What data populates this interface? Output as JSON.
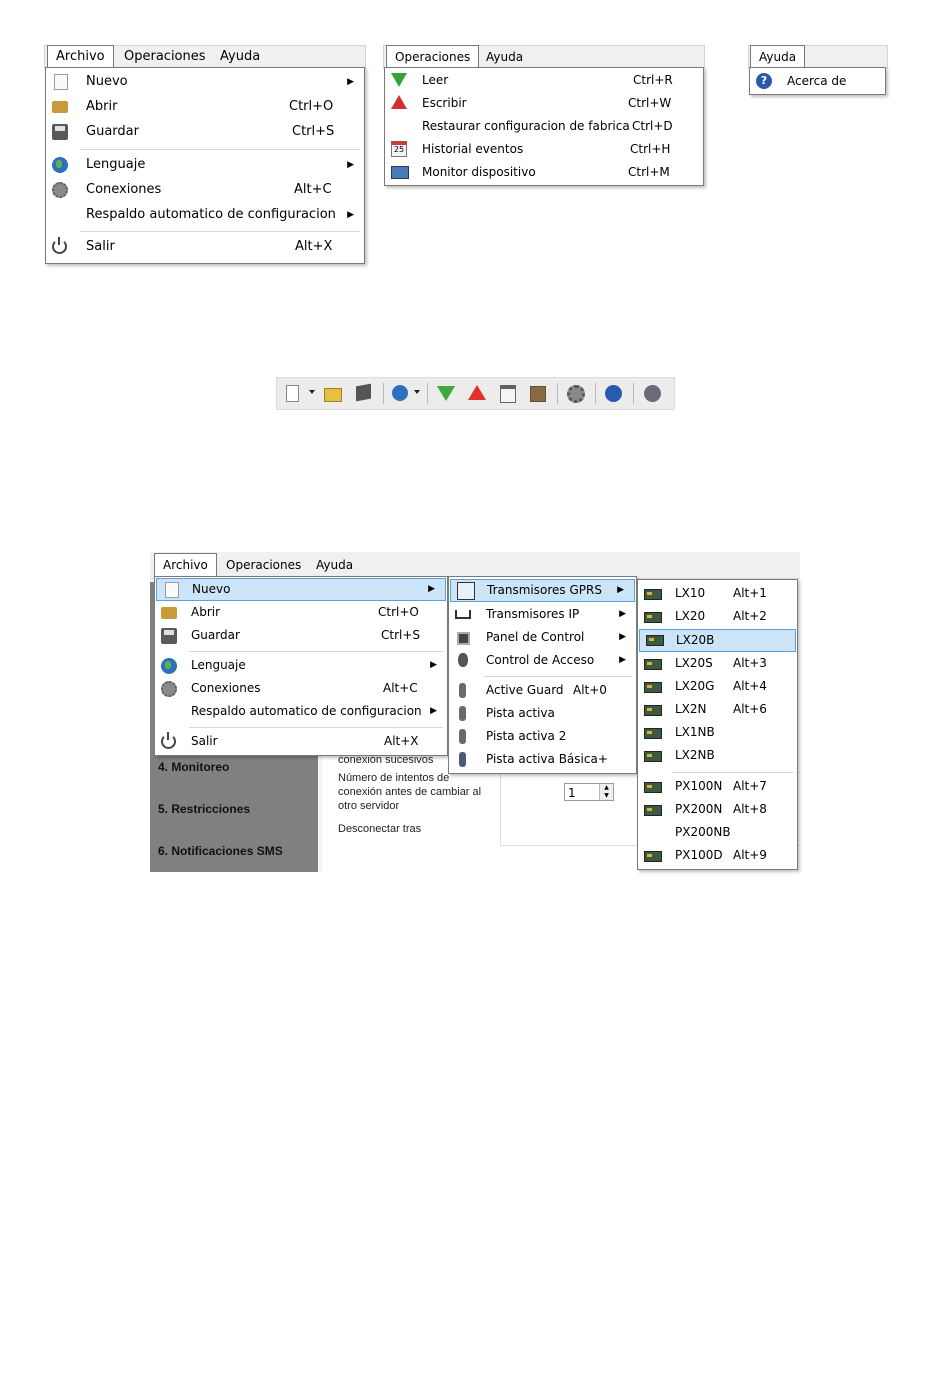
{
  "shot1": {
    "menubar": [
      {
        "label": "Archivo"
      },
      {
        "label": "Operaciones"
      },
      {
        "label": "Ayuda"
      }
    ],
    "archivo_menu": [
      {
        "icon": "new-document-icon",
        "label": "Nuevo",
        "shortcut": "",
        "submenu": true
      },
      {
        "icon": "folder-icon",
        "label": "Abrir",
        "shortcut": "Ctrl+O",
        "submenu": false
      },
      {
        "icon": "save-icon",
        "label": "Guardar",
        "shortcut": "Ctrl+S",
        "submenu": false
      },
      {
        "icon": "globe-icon",
        "label": "Lenguaje",
        "shortcut": "",
        "submenu": true
      },
      {
        "icon": "gear-icon",
        "label": "Conexiones",
        "shortcut": "Alt+C",
        "submenu": false
      },
      {
        "icon": "",
        "label": "Respaldo automatico de configuracion",
        "shortcut": "",
        "submenu": true
      },
      {
        "icon": "power-icon",
        "label": "Salir",
        "shortcut": "Alt+X",
        "submenu": false
      }
    ]
  },
  "shot2": {
    "menubar": [
      {
        "label": "Operaciones"
      },
      {
        "label": "Ayuda"
      }
    ],
    "operaciones_menu": [
      {
        "icon": "download-arrow-icon",
        "label": "Leer",
        "shortcut": "Ctrl+R"
      },
      {
        "icon": "upload-arrow-icon",
        "label": "Escribir",
        "shortcut": "Ctrl+W"
      },
      {
        "icon": "",
        "label": "Restaurar configuracion de fabrica",
        "shortcut": "Ctrl+D"
      },
      {
        "icon": "calendar-icon",
        "label": "Historial eventos",
        "shortcut": "Ctrl+H"
      },
      {
        "icon": "monitor-icon",
        "label": "Monitor dispositivo",
        "shortcut": "Ctrl+M"
      }
    ],
    "calendar_day": "25"
  },
  "shot3": {
    "menubar": [
      {
        "label": "Ayuda"
      }
    ],
    "ayuda_menu": [
      {
        "icon": "help-icon",
        "label": "Acerca de",
        "shortcut": ""
      }
    ],
    "help_glyph": "?"
  },
  "toolbar": {
    "buttons": [
      "new-document-icon",
      "open-folder-icon",
      "save-icon",
      "language-globe-icon",
      "read-download-icon",
      "write-upload-icon",
      "event-history-icon",
      "monitor-icon",
      "connections-gear-icon",
      "help-icon",
      "exit-icon"
    ]
  },
  "shot4": {
    "menubar": [
      {
        "label": "Archivo"
      },
      {
        "label": "Operaciones"
      },
      {
        "label": "Ayuda"
      }
    ],
    "archivo_menu": [
      {
        "label": "Nuevo",
        "shortcut": "",
        "submenu": true
      },
      {
        "label": "Abrir",
        "shortcut": "Ctrl+O",
        "submenu": false
      },
      {
        "label": "Guardar",
        "shortcut": "Ctrl+S",
        "submenu": false
      },
      {
        "label": "Lenguaje",
        "shortcut": "",
        "submenu": true
      },
      {
        "label": "Conexiones",
        "shortcut": "Alt+C",
        "submenu": false
      },
      {
        "label": "Respaldo automatico de configuracion",
        "shortcut": "",
        "submenu": true
      },
      {
        "label": "Salir",
        "shortcut": "Alt+X",
        "submenu": false
      }
    ],
    "nuevo_menu": [
      {
        "label": "Transmisores GPRS",
        "shortcut": "",
        "submenu": true
      },
      {
        "label": "Transmisores IP",
        "shortcut": "",
        "submenu": true
      },
      {
        "label": "Panel de Control",
        "shortcut": "",
        "submenu": true
      },
      {
        "label": "Control de Acceso",
        "shortcut": "",
        "submenu": true
      },
      {
        "label": "Active Guard",
        "shortcut": "Alt+0",
        "submenu": false
      },
      {
        "label": "Pista activa",
        "shortcut": "",
        "submenu": false
      },
      {
        "label": "Pista activa 2",
        "shortcut": "",
        "submenu": false
      },
      {
        "label": "Pista activa Básica+",
        "shortcut": "",
        "submenu": false
      }
    ],
    "gprs_menu": [
      {
        "label": "LX10",
        "shortcut": "Alt+1"
      },
      {
        "label": "LX20",
        "shortcut": "Alt+2"
      },
      {
        "label": "LX20B",
        "shortcut": ""
      },
      {
        "label": "LX20S",
        "shortcut": "Alt+3"
      },
      {
        "label": "LX20G",
        "shortcut": "Alt+4"
      },
      {
        "label": "LX2N",
        "shortcut": "Alt+6"
      },
      {
        "label": "LX1NB",
        "shortcut": ""
      },
      {
        "label": "LX2NB",
        "shortcut": ""
      },
      {
        "label": "PX100N",
        "shortcut": "Alt+7"
      },
      {
        "label": "PX200N",
        "shortcut": "Alt+8"
      },
      {
        "label": "PX200NB",
        "shortcut": ""
      },
      {
        "label": "PX100D",
        "shortcut": "Alt+9"
      }
    ],
    "background": {
      "sidebar": [
        "4. Monitoreo",
        "5. Restricciones",
        "6. Notificaciones SMS"
      ],
      "text1": "conexión sucesivos",
      "text2": "Número de intentos de",
      "text3": "conexión antes de cambiar al",
      "text4": "otro servidor",
      "text5": "Desconectar tras",
      "spin_value": "1"
    },
    "colors": {
      "highlight": "#cce4f7",
      "highlight_border": "#5aa0e0",
      "sidebar": "#808080"
    }
  }
}
